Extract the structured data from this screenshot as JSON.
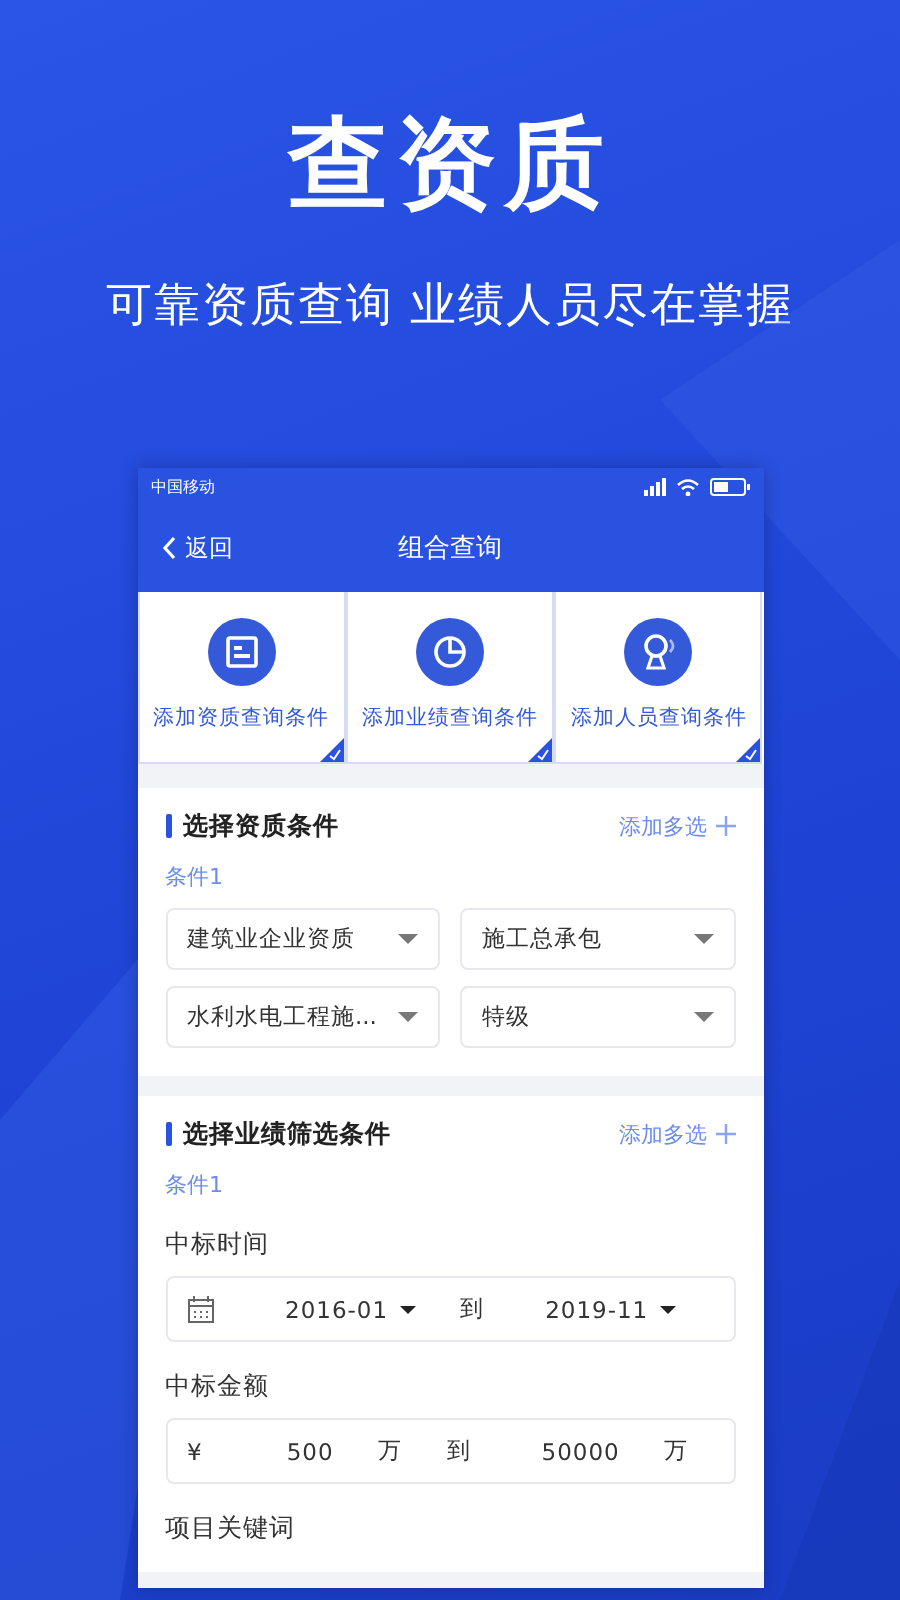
{
  "headline": "查资质",
  "subtitle": "可靠资质查询 业绩人员尽在掌握",
  "status_bar": {
    "carrier": "中国移动"
  },
  "nav": {
    "back": "返回",
    "title": "组合查询"
  },
  "cards": [
    {
      "kind": "document",
      "label": "添加资质查询条件"
    },
    {
      "kind": "pie",
      "label": "添加业绩查询条件"
    },
    {
      "kind": "person",
      "label": "添加人员查询条件"
    }
  ],
  "qualification": {
    "title": "选择资质条件",
    "action": "添加多选",
    "condition": "条件1",
    "selects": [
      {
        "value": "建筑业企业资质"
      },
      {
        "value": "施工总承包"
      },
      {
        "value": "水利水电工程施..."
      },
      {
        "value": "特级"
      }
    ]
  },
  "performance": {
    "title": "选择业绩筛选条件",
    "action": "添加多选",
    "condition": "条件1",
    "time": {
      "label": "中标时间",
      "from": "2016-01",
      "to_word": "到",
      "to": "2019-11"
    },
    "amount": {
      "label": "中标金额",
      "currency": "¥",
      "from": "500",
      "from_unit": "万",
      "to_word": "到",
      "to": "50000",
      "to_unit": "万"
    },
    "keyword": {
      "label": "项目关键词"
    }
  }
}
